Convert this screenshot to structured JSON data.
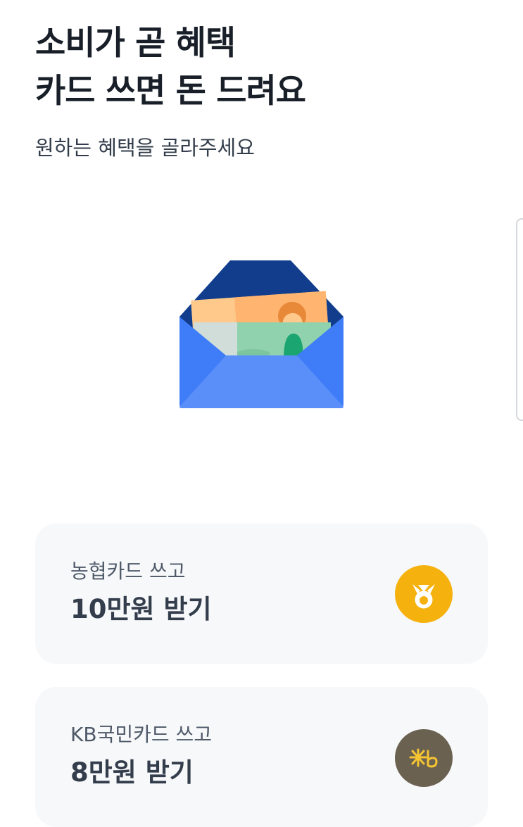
{
  "header": {
    "title_line1": "소비가 곧 혜택",
    "title_line2": "카드 쓰면 돈 드려요",
    "subtitle": "원하는 혜택을 골라주세요"
  },
  "illustration": {
    "icon": "money-envelope-icon"
  },
  "cards": [
    {
      "subtitle": "농협카드 쓰고",
      "title": "10만원 받기",
      "logo": "nh-card-logo-icon",
      "logo_color": "#f5b20f"
    },
    {
      "subtitle": "KB국민카드 쓰고",
      "title": "8만원 받기",
      "logo": "kb-card-logo-icon",
      "logo_color": "#6b6151"
    }
  ],
  "colors": {
    "title": "#191f28",
    "card_background": "#f7f8fa",
    "envelope_blue": "#3f7cf7",
    "envelope_dark": "#113d8c"
  }
}
